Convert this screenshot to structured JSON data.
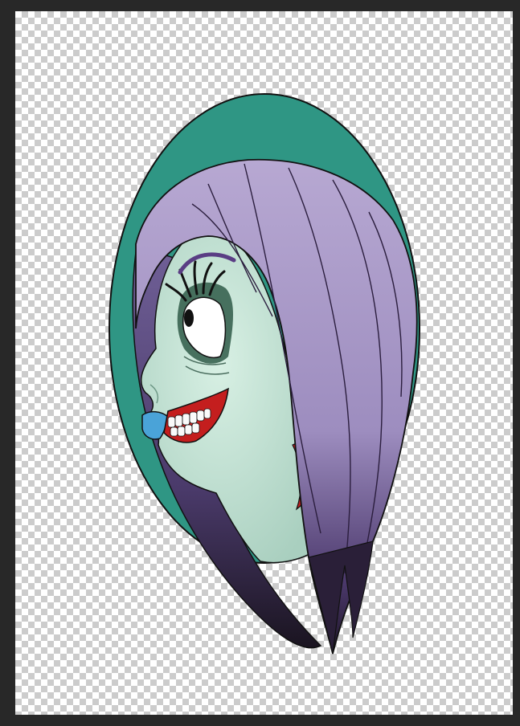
{
  "document": {
    "background": "transparent-checkerboard",
    "artwork_subject": "zombie-girl-portrait"
  },
  "colors": {
    "workspace": "#282828",
    "oval_background": "#2f9684",
    "skin": "#cde9dc",
    "skin_shadow": "#9fc7b6",
    "hair_light": "#b3a3cd",
    "hair_mid": "#8e7fae",
    "hair_dark": "#3e2d5a",
    "lips": "#4aa3d8",
    "blood_red": "#c41e1e",
    "outline": "#111111"
  }
}
